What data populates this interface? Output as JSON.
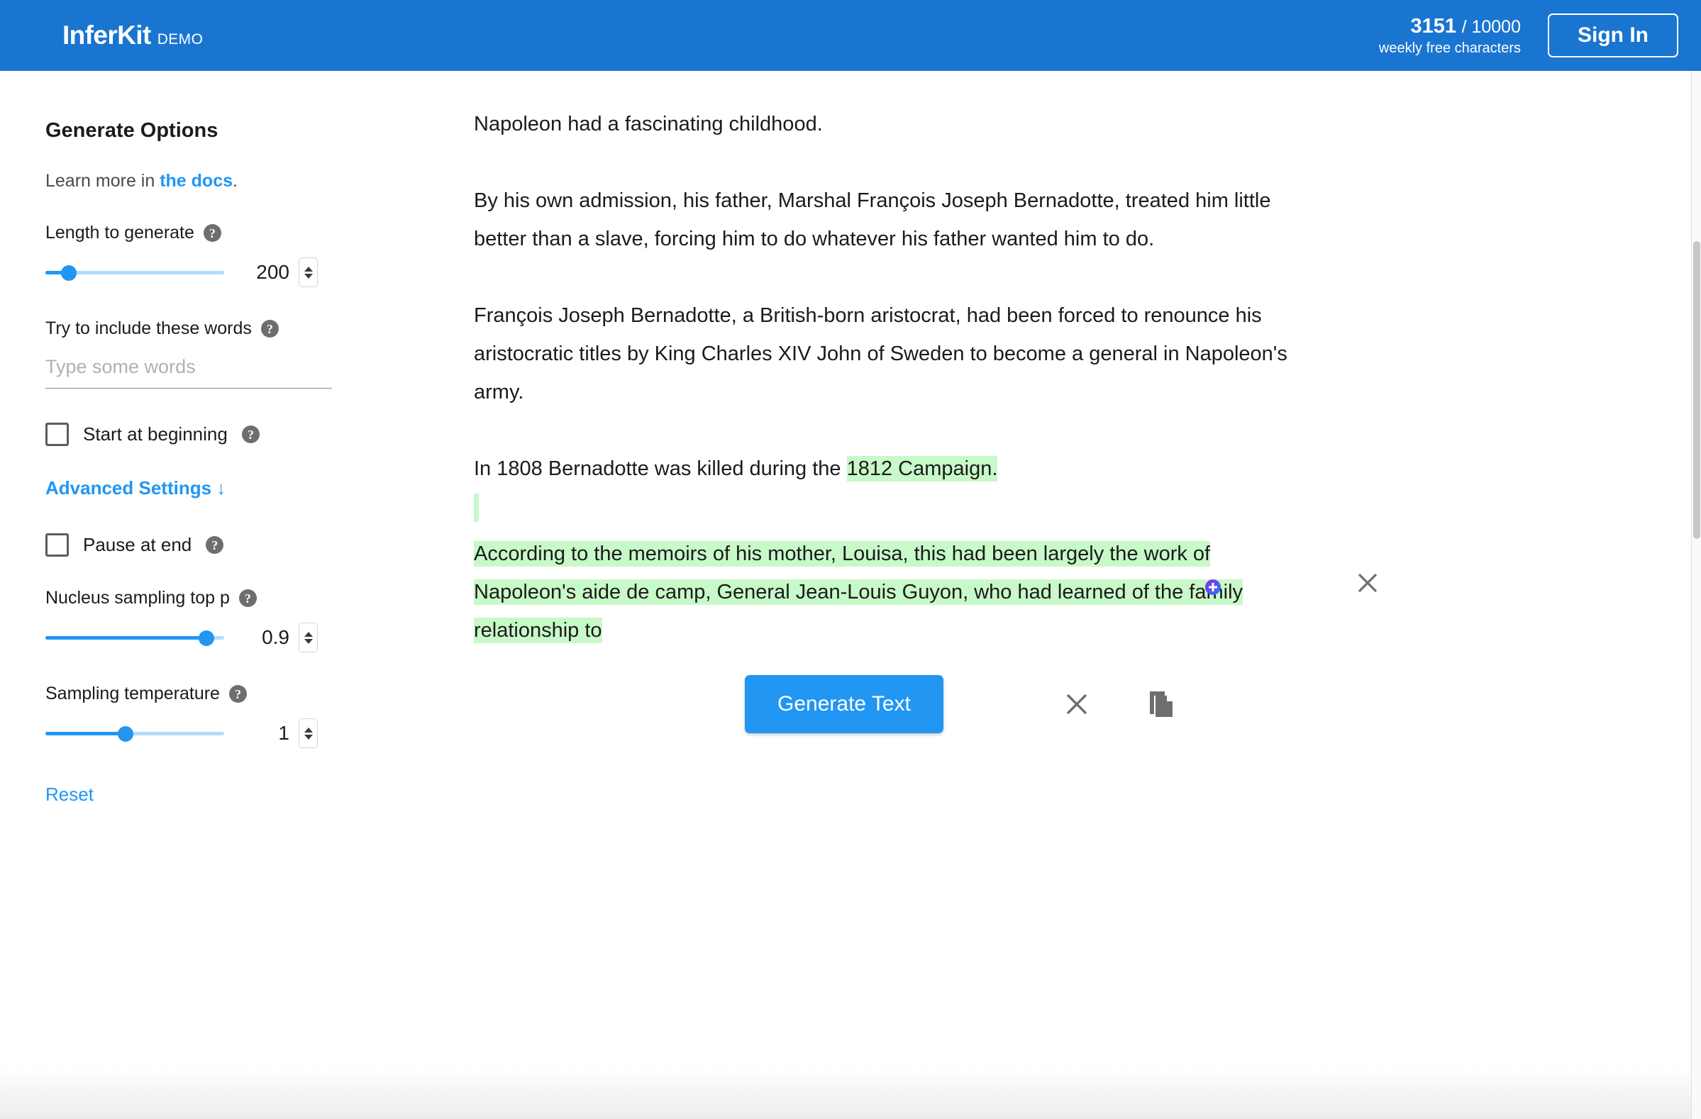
{
  "header": {
    "brand_name": "InferKit",
    "brand_sub": "DEMO",
    "quota_used": "3151",
    "quota_total": "/ 10000",
    "quota_label": "weekly free characters",
    "signin_label": "Sign In",
    "background_color": "#1a75d1"
  },
  "sidebar": {
    "panel_title": "Generate Options",
    "learn_more_prefix": "Learn more in ",
    "learn_more_link": "the docs",
    "learn_more_suffix": ".",
    "length": {
      "label": "Length to generate",
      "help": "?",
      "value": "200",
      "slider_percent": 13
    },
    "include_words": {
      "label": "Try to include these words",
      "help": "?",
      "value": "",
      "placeholder": "Type some words"
    },
    "start_at_beginning": {
      "label": "Start at beginning",
      "help": "?",
      "checked": false
    },
    "advanced_settings_label": "Advanced Settings ↓",
    "pause_at_end": {
      "label": "Pause at end",
      "help": "?",
      "checked": false
    },
    "top_p": {
      "label": "Nucleus sampling top p",
      "help": "?",
      "value": "0.9",
      "slider_percent": 90
    },
    "temperature": {
      "label": "Sampling temperature",
      "help": "?",
      "value": "1",
      "slider_percent": 45
    },
    "reset_label": "Reset",
    "accent_color": "#2196f3"
  },
  "document": {
    "paragraph_1": "Napoleon had a fascinating childhood.",
    "paragraph_2": "By his own admission, his father, Marshal François Joseph Bernadotte, treated him little better than a slave, forcing him to do whatever his father wanted him to do.",
    "paragraph_3": "François Joseph Bernadotte, a British-born aristocrat, had been forced to renounce his aristocratic titles by King Charles XIV John of Sweden to become a general in Napoleon's army.",
    "paragraph_4_plain": "In 1808 Bernadotte was killed during the ",
    "paragraph_4_highlight": "1812 Campaign.",
    "paragraph_5_highlight": "According to the memoirs of his mother, Louisa, this had been largely the work of Napoleon's aide de camp, General Jean-Louis Guyon, who had learned of the family relationship to",
    "highlight_color": "#c8f9c8"
  },
  "actions": {
    "generate_label": "Generate Text",
    "clear_icon": "close-icon",
    "copy_icon": "copy-icon",
    "dismiss_icon": "close-icon",
    "add_icon": "plus-circle-icon",
    "generate_color": "#2196f3"
  }
}
